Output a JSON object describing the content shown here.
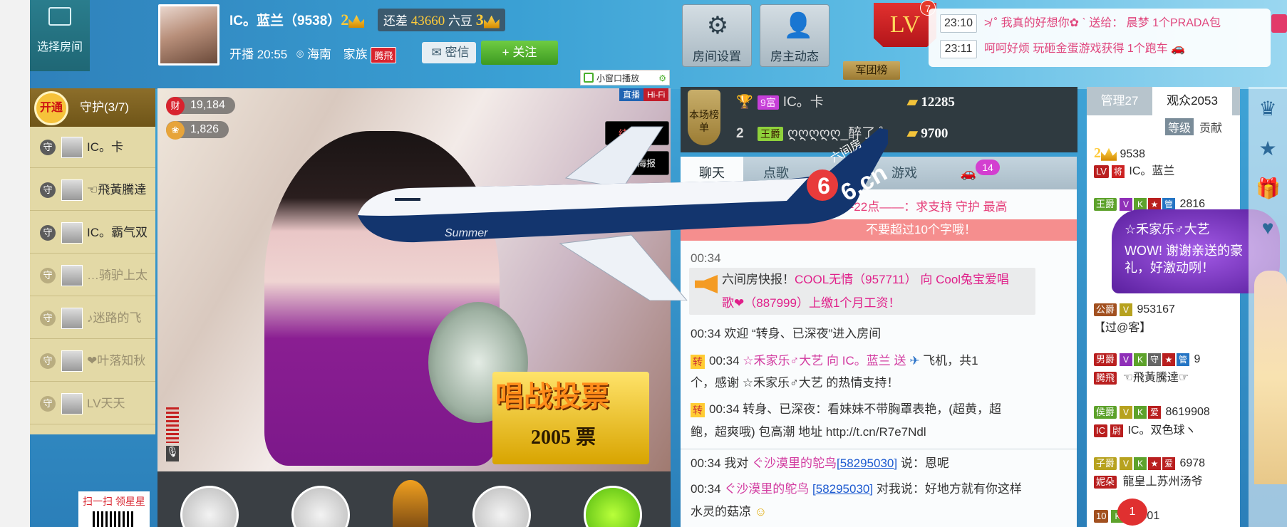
{
  "colors": {
    "accent": "#3aa0d4",
    "follow": "#4caf2e",
    "badge": "#d8232e",
    "chat_pink": "#e63f7a"
  },
  "header": {
    "select_room": "选择房间",
    "host_name": "IC。蓝兰（9538）",
    "host_level": "2",
    "remain_label": "还差",
    "remain_value": "43660",
    "remain_unit": "六豆",
    "next_level": "3",
    "live_time": "开播 20:55",
    "location": "海南",
    "family_label": "家族",
    "family_tag": "腾飛",
    "letter_btn": "密信",
    "follow_btn": "+ 关注",
    "room_settings": "房间设置",
    "host_updates": "房主动态",
    "lv_label": "LV",
    "lv_badge": "7",
    "army_rank": "军团榜"
  },
  "feed": [
    {
      "time": "23:10",
      "text": "≯ ˚ 我真的好想你✿ ˋ  送给： 晨梦 1个PRADA包"
    },
    {
      "time": "23:11",
      "text": "呵呵好烦 玩砸金蛋游戏获得 1个跑车"
    }
  ],
  "guards": {
    "open_label": "开通",
    "title": "守护(3/7)",
    "items": [
      {
        "badge": "守",
        "name": "IC。卡",
        "dim": false
      },
      {
        "badge": "守",
        "name": "☜飛黃騰達",
        "dim": false
      },
      {
        "badge": "守",
        "name": "IC。霸气双",
        "dim": false
      },
      {
        "badge": "守",
        "name": "…骑驴上太",
        "dim": true
      },
      {
        "badge": "守",
        "name": "♪迷路的飞",
        "dim": true
      },
      {
        "badge": "守",
        "name": "❤叶落知秋",
        "dim": true
      },
      {
        "badge": "守",
        "name": "LV天天",
        "dim": true
      }
    ]
  },
  "video": {
    "wealth_icon": "财",
    "wealth": "19,184",
    "flowers": "1,826",
    "end_live": "结束直播",
    "live_poster": "直播海报",
    "mini_window": "小窗口播放",
    "live_tag": "直播",
    "hifi_tag": "Hi-Fi",
    "vote_title": "唱战投票",
    "vote_count": "2005 票",
    "plane_brand": "六间房",
    "plane_site": "6.cn",
    "plane_name": "Summer",
    "qr_label": "扫一扫 领星星"
  },
  "ranking": {
    "label": "本场榜单",
    "rows": [
      {
        "rank": "",
        "tag": "9富",
        "name": "IC。卡",
        "gold": "12285"
      },
      {
        "rank": "2",
        "tag": "王爵",
        "name": "ღღღღღ_醉了 ˚",
        "gold": "9700"
      }
    ]
  },
  "chat": {
    "tabs": [
      "聊天",
      "点歌",
      "",
      "游戏",
      ""
    ],
    "tab_badge": "14",
    "notice_top": "间： 19-22点——：求支持 守护 最高",
    "notice_bar": "不要超过10个字哦！",
    "lines": [
      {
        "text": "00:34"
      },
      {
        "text": "00:34 欢迎 “转身、已深夜”进入房间"
      },
      {
        "time": "00:34",
        "pre": "☆禾家乐♂大艺 向 IC。蓝兰 送",
        "post": "飞机，共1"
      },
      {
        "text": "个，感谢 ☆禾家乐♂大艺 的热情支持！"
      },
      {
        "time": "00:34",
        "pre": "转身、已深夜：看妹妹不带胸罩表艳，(超黄，超"
      },
      {
        "text": "鲍，超爽哦) 包高潮 地址 http://t.cn/R7e7Ndl"
      },
      {
        "time": "00:34",
        "pre": "我对",
        "name": "ぐ沙漠里的鸵鸟",
        "id": "[58295030]",
        "post": "说：恩呢"
      },
      {
        "time": "00:34",
        "name": "ぐ沙漠里的鸵鸟",
        "id": "[58295030]",
        "post": "对我说：好地方就有你这样"
      },
      {
        "text": "水灵的菇凉"
      }
    ],
    "flash_label": "六间房快报！",
    "flash_p1": "COOL无情（957711） 向 Cool兔宝爱唱",
    "flash_p2": "歌❤（887999）上缴1个月工资！",
    "zhuan": "转"
  },
  "users": {
    "tab_admin": "管理27",
    "tab_viewers": "观众2053",
    "sub_level": "等级",
    "sub_contrib": "贡献",
    "rows": [
      {
        "lvl": "2",
        "id": "9538",
        "tag": "LV",
        "name": "IC。蓝兰"
      },
      {
        "tag": "王爵",
        "id": "2816"
      },
      {
        "tag": "公爵",
        "id": "953167",
        "name": "【过@客】"
      },
      {
        "tag": "男爵",
        "id": "9",
        "name": "☜飛黃騰達☞"
      },
      {
        "tag": "侯爵",
        "id": "8619908",
        "name": "IC。双色球ヽ"
      },
      {
        "tag": "子爵",
        "id": "6978",
        "name": "龍皇丄苏州汤爷"
      },
      {
        "tag": "10",
        "id": "11501"
      }
    ],
    "bubble_name": "☆禾家乐♂大艺",
    "bubble_text": "WOW! 谢谢亲送的豪礼，好激动咧！",
    "notif": "1"
  }
}
